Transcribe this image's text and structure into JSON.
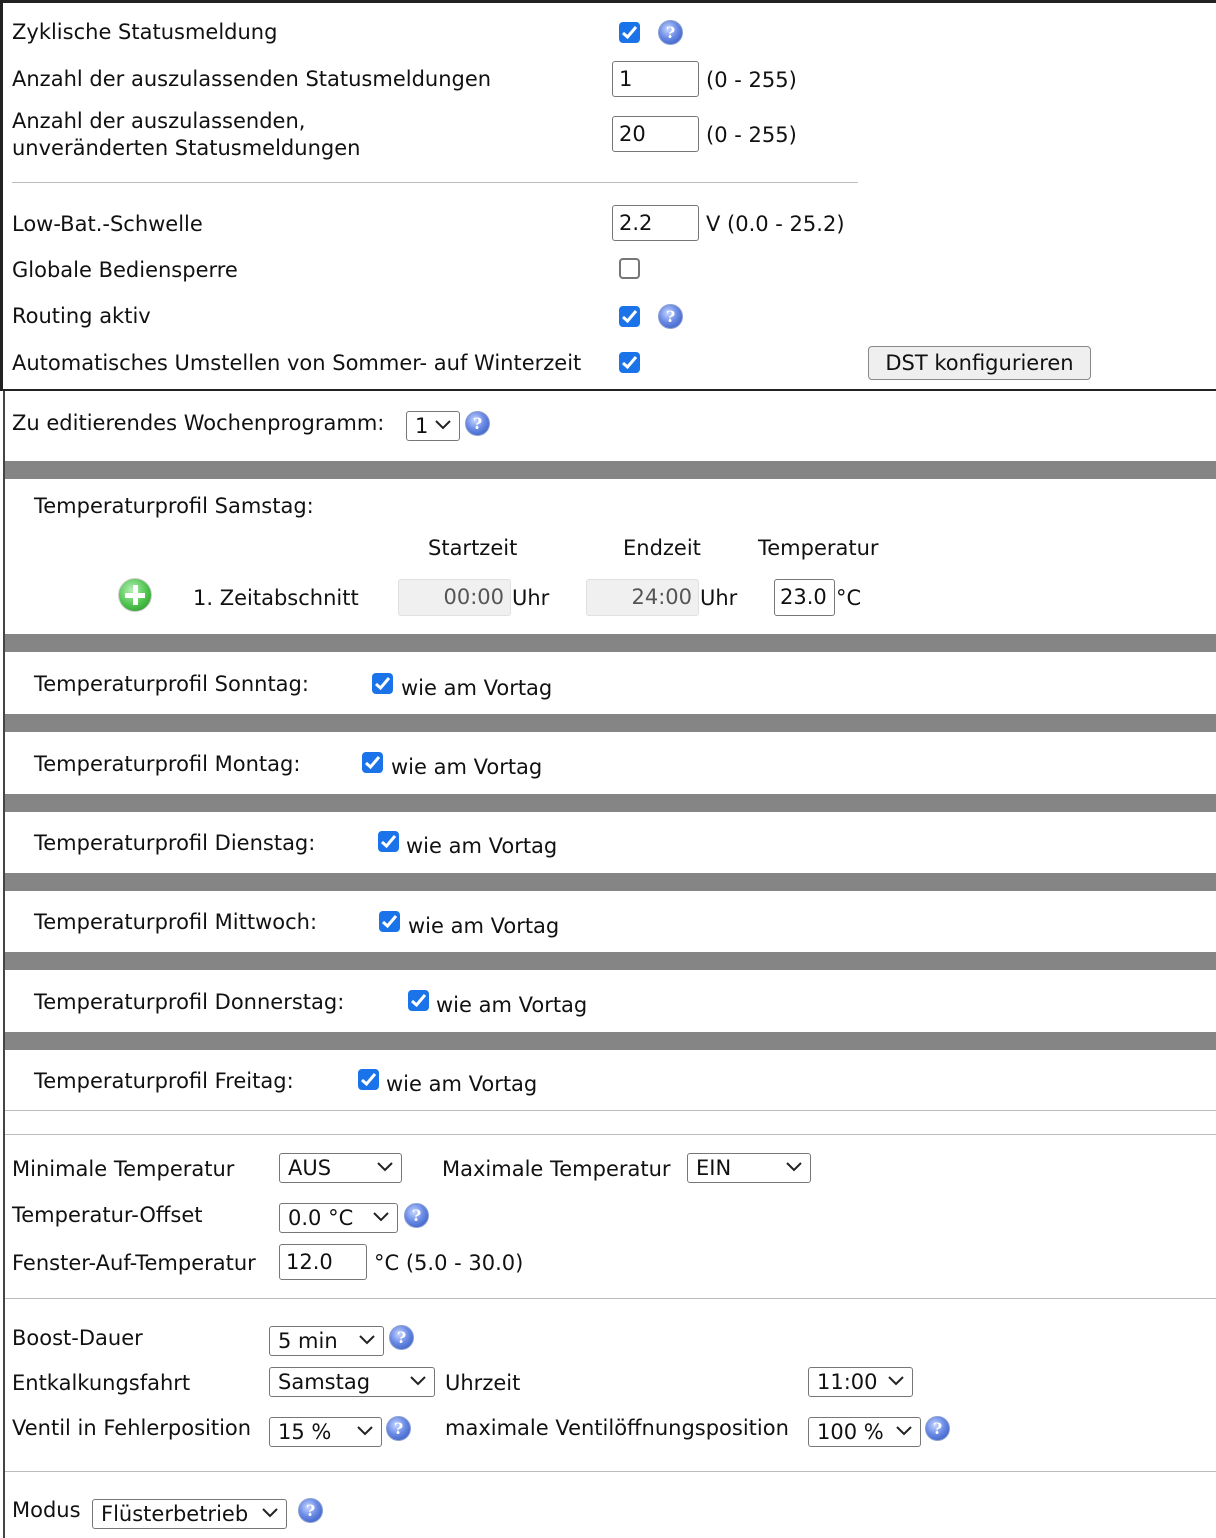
{
  "general": {
    "cyclic_status": {
      "label": "Zyklische Statusmeldung",
      "checked": true
    },
    "skip_status": {
      "label": "Anzahl der auszulassenden Statusmeldungen",
      "value": "1",
      "range": "(0 - 255)"
    },
    "skip_unchanged": {
      "label_line1": "Anzahl der auszulassenden,",
      "label_line2": "unveränderten Statusmeldungen",
      "value": "20",
      "range": "(0 - 255)"
    },
    "low_bat": {
      "label": "Low-Bat.-Schwelle",
      "value": "2.2",
      "range": "V (0.0 - 25.2)"
    },
    "global_lock": {
      "label": "Globale Bediensperre",
      "checked": false
    },
    "routing": {
      "label": "Routing aktiv",
      "checked": true
    },
    "auto_dst": {
      "label": "Automatisches Umstellen von Sommer- auf Winterzeit",
      "checked": true
    },
    "dst_button": "DST konfigurieren"
  },
  "week_program": {
    "label": "Zu editierendes Wochenprogramm:",
    "selected": "1"
  },
  "saturday": {
    "title": "Temperaturprofil Samstag:",
    "col_start": "Startzeit",
    "col_end": "Endzeit",
    "col_temp": "Temperatur",
    "period_label": "1. Zeitabschnitt",
    "start": "00:00",
    "end": "24:00",
    "temp": "23.0",
    "unit_time": "Uhr",
    "unit_temp": "°C"
  },
  "days": [
    {
      "title": "Temperaturprofil Sonntag:",
      "same": "wie am Vortag",
      "checked": true
    },
    {
      "title": "Temperaturprofil Montag:",
      "same": "wie am Vortag",
      "checked": true
    },
    {
      "title": "Temperaturprofil Dienstag:",
      "same": "wie am Vortag",
      "checked": true
    },
    {
      "title": "Temperaturprofil Mittwoch:",
      "same": "wie am Vortag",
      "checked": true
    },
    {
      "title": "Temperaturprofil Donnerstag:",
      "same": "wie am Vortag",
      "checked": true
    },
    {
      "title": "Temperaturprofil Freitag:",
      "same": "wie am Vortag",
      "checked": true
    }
  ],
  "temps": {
    "min_label": "Minimale Temperatur",
    "min_value": "AUS",
    "max_label": "Maximale Temperatur",
    "max_value": "EIN",
    "offset_label": "Temperatur-Offset",
    "offset_value": "0.0 °C",
    "window_label": "Fenster-Auf-Temperatur",
    "window_value": "12.0",
    "window_range": "°C (5.0 - 30.0)"
  },
  "boost": {
    "boost_label": "Boost-Dauer",
    "boost_value": "5 min",
    "decalc_label": "Entkalkungsfahrt",
    "decalc_value": "Samstag",
    "time_label": "Uhrzeit",
    "time_value": "11:00",
    "valve_error_label": "Ventil in Fehlerposition",
    "valve_error_value": "15 %",
    "valve_max_label": "maximale Ventilöffnungsposition",
    "valve_max_value": "100 %"
  },
  "mode": {
    "label": "Modus",
    "value": "Flüsterbetrieb"
  },
  "icons": {
    "help": "help-icon",
    "add": "add-icon",
    "checkbox_color": "#1a73e8",
    "bar_color": "#858585"
  }
}
